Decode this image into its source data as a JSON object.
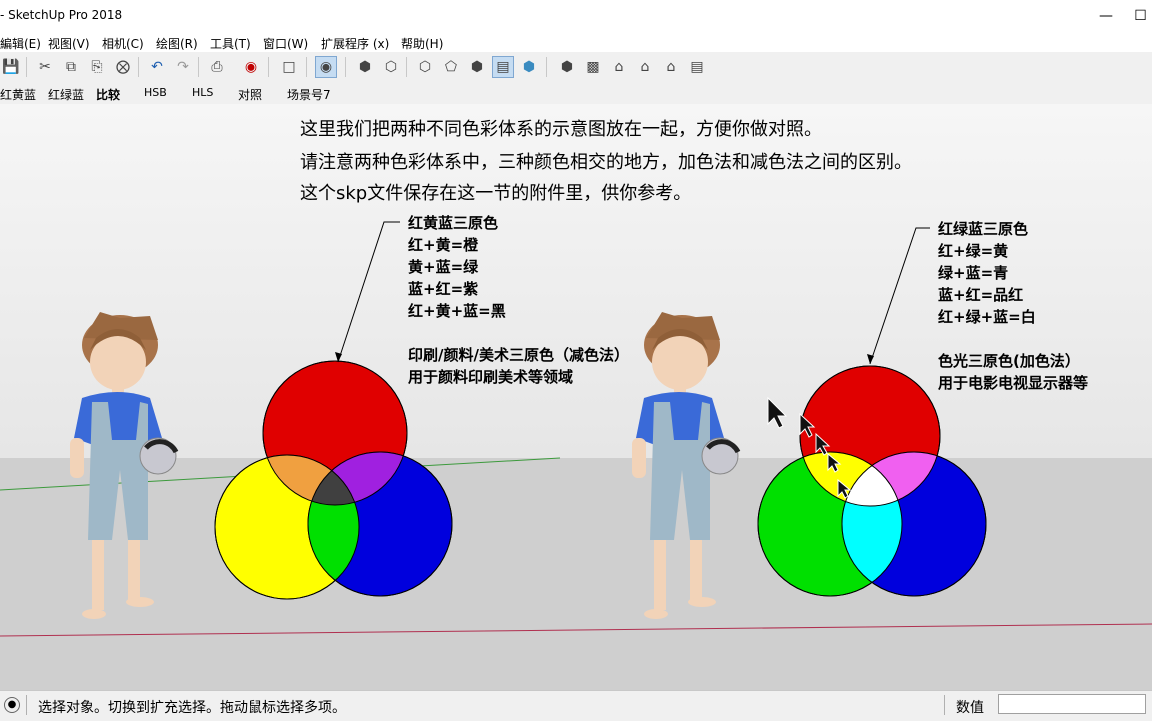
{
  "window": {
    "title": "- SketchUp Pro 2018"
  },
  "menu": [
    "編辑(E)",
    "视图(V)",
    "相机(C)",
    "绘图(R)",
    "工具(T)",
    "窗口(W)",
    "扩展程序 (x)",
    "帮助(H)"
  ],
  "scene_tabs": [
    "红黄蓝",
    "红绿蓝",
    "比较",
    "HSB",
    "HLS",
    "对照",
    "场景号7"
  ],
  "notes": [
    "这里我们把两种不同色彩体系的示意图放在一起，方便你做对照。",
    "请注意两种色彩体系中，三种颜色相交的地方，加色法和减色法之间的区别。",
    "这个skp文件保存在这一节的附件里，供你参考。"
  ],
  "left_label": {
    "title": "红黄蓝三原色",
    "lines": [
      "红+黄=橙",
      "黄+蓝=绿",
      "蓝+红=紫",
      "红+黄+蓝=黑"
    ],
    "desc1": "印刷/颜料/美术三原色（减色法）",
    "desc2": "用于颜料印刷美术等领域"
  },
  "right_label": {
    "title": "红绿蓝三原色",
    "lines": [
      "红+绿=黄",
      "绿+蓝=青",
      "蓝+红=品红",
      "红+绿+蓝=白"
    ],
    "desc1": "色光三原色(加色法）",
    "desc2": "用于电影电视显示器等"
  },
  "status": {
    "message": "选择对象。切换到扩充选择。拖动鼠标选择多项。",
    "measure_label": "数值",
    "measure_value": ""
  },
  "colors": {
    "red": "#e00000",
    "yellow": "#ffff00",
    "blue": "#0000dd",
    "green": "#00e000",
    "orange": "#f0a040",
    "purple": "#a020e0",
    "dark": "#404040",
    "cyan": "#00ffff",
    "magenta": "#f060f0",
    "white": "#ffffff"
  }
}
